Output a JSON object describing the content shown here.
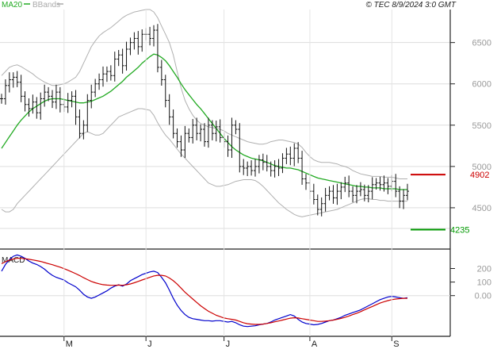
{
  "chart_data": [
    {
      "type": "ohlc",
      "header": {
        "legend": [
          {
            "label": "MA20",
            "color": "#22aa22"
          },
          {
            "label": "BBands",
            "color": "#aaaaaa"
          }
        ],
        "copyright": "© TEC 8/9/2024 3:0 GMT"
      },
      "ylim": [
        4000,
        6900
      ],
      "yticks": [
        {
          "value": 6500,
          "label": "6500"
        },
        {
          "value": 6000,
          "label": "6000"
        },
        {
          "value": 5500,
          "label": "5500"
        },
        {
          "value": 5000,
          "label": "5000"
        },
        {
          "value": 4500,
          "label": "4500"
        }
      ],
      "xticks": [
        {
          "index": 16,
          "label": "M"
        },
        {
          "index": 37,
          "label": "J"
        },
        {
          "index": 57,
          "label": "J"
        },
        {
          "index": 79,
          "label": "A"
        },
        {
          "index": 100,
          "label": "S"
        }
      ],
      "levels": [
        {
          "value": 4902,
          "label": "4902",
          "color": "#cc0000"
        },
        {
          "value": 4235,
          "label": "4235",
          "color": "#009900"
        }
      ],
      "close": [
        5820,
        5980,
        6050,
        6080,
        6020,
        5850,
        5750,
        5700,
        5780,
        5650,
        5820,
        5900,
        5850,
        5780,
        5900,
        5750,
        5720,
        5800,
        5850,
        5600,
        5400,
        5500,
        5800,
        5900,
        6000,
        6050,
        6120,
        6150,
        6100,
        6300,
        6350,
        6220,
        6420,
        6500,
        6550,
        6450,
        6600,
        6600,
        6550,
        6650,
        6200,
        6050,
        5800,
        5600,
        5400,
        5300,
        5200,
        5400,
        5350,
        5500,
        5400,
        5450,
        5300,
        5500,
        5400,
        5480,
        5350,
        5300,
        5200,
        5500,
        5450,
        5000,
        4980,
        5000,
        4950,
        5000,
        5080,
        5050,
        5000,
        4950,
        5000,
        4980,
        5100,
        5150,
        5100,
        5220,
        5100,
        4850,
        4800,
        4700,
        4600,
        4480,
        4550,
        4650,
        4700,
        4620,
        4700,
        4750,
        4800,
        4700,
        4650,
        4700,
        4720,
        4650,
        4700,
        4780,
        4800,
        4780,
        4800,
        4760,
        4820,
        4700,
        4580,
        4650,
        4700
      ],
      "ma20": [
        5220,
        5290,
        5360,
        5430,
        5500,
        5560,
        5610,
        5660,
        5700,
        5730,
        5760,
        5790,
        5810,
        5820,
        5820,
        5820,
        5810,
        5800,
        5790,
        5780,
        5770,
        5770,
        5780,
        5790,
        5810,
        5830,
        5850,
        5880,
        5910,
        5950,
        5990,
        6030,
        6080,
        6120,
        6160,
        6200,
        6250,
        6290,
        6330,
        6360,
        6350,
        6320,
        6280,
        6220,
        6150,
        6080,
        6000,
        5930,
        5870,
        5810,
        5750,
        5700,
        5640,
        5580,
        5520,
        5460,
        5400,
        5340,
        5290,
        5240,
        5200,
        5170,
        5140,
        5120,
        5100,
        5090,
        5080,
        5070,
        5050,
        5030,
        5010,
        5000,
        4990,
        4980,
        4980,
        4970,
        4960,
        4940,
        4920,
        4900,
        4880,
        4860,
        4850,
        4840,
        4830,
        4820,
        4810,
        4800,
        4790,
        4780,
        4770,
        4760,
        4760,
        4750,
        4750,
        4740,
        4740,
        4740,
        4730,
        4730,
        4730,
        4730,
        4720,
        4720,
        4720
      ],
      "bb_upper": [
        6100,
        6150,
        6200,
        6220,
        6230,
        6210,
        6180,
        6150,
        6120,
        6080,
        6050,
        6020,
        6000,
        5980,
        5980,
        5990,
        6000,
        6020,
        6050,
        6080,
        6150,
        6250,
        6350,
        6450,
        6520,
        6580,
        6620,
        6650,
        6680,
        6720,
        6760,
        6800,
        6830,
        6850,
        6870,
        6880,
        6890,
        6900,
        6900,
        6870,
        6800,
        6700,
        6600,
        6500,
        6350,
        6150,
        5950,
        5800,
        5700,
        5620,
        5560,
        5520,
        5500,
        5480,
        5470,
        5460,
        5450,
        5430,
        5400,
        5380,
        5360,
        5340,
        5320,
        5300,
        5290,
        5280,
        5270,
        5270,
        5280,
        5300,
        5310,
        5320,
        5320,
        5310,
        5300,
        5290,
        5270,
        5230,
        5170,
        5120,
        5080,
        5060,
        5050,
        5050,
        5050,
        5040,
        5030,
        5010,
        5000,
        4980,
        4950,
        4930,
        4910,
        4900,
        4890,
        4880,
        4880,
        4880,
        4870,
        4870,
        4870,
        4860,
        4850,
        4850,
        4850
      ],
      "bb_lower": [
        4480,
        4450,
        4450,
        4480,
        4550,
        4600,
        4650,
        4700,
        4750,
        4800,
        4850,
        4900,
        4950,
        5000,
        5050,
        5100,
        5150,
        5200,
        5250,
        5300,
        5350,
        5400,
        5420,
        5400,
        5380,
        5380,
        5400,
        5450,
        5500,
        5550,
        5600,
        5620,
        5640,
        5660,
        5680,
        5700,
        5700,
        5690,
        5680,
        5620,
        5530,
        5450,
        5380,
        5330,
        5270,
        5210,
        5150,
        5100,
        5050,
        5000,
        4950,
        4900,
        4850,
        4800,
        4780,
        4760,
        4760,
        4770,
        4780,
        4800,
        4820,
        4830,
        4840,
        4840,
        4840,
        4830,
        4800,
        4760,
        4710,
        4660,
        4610,
        4560,
        4520,
        4480,
        4450,
        4420,
        4400,
        4390,
        4400,
        4410,
        4420,
        4430,
        4440,
        4450,
        4460,
        4470,
        4480,
        4500,
        4520,
        4540,
        4560,
        4580,
        4600,
        4610,
        4610,
        4600,
        4600,
        4590,
        4590,
        4580,
        4580,
        4580,
        4580,
        4580,
        4580
      ]
    },
    {
      "type": "line",
      "title": "MACD",
      "ylim": [
        -300,
        320
      ],
      "yticks": [
        {
          "value": 200,
          "label": "200"
        },
        {
          "value": 100,
          "label": "100"
        },
        {
          "value": 0,
          "label": "0.00"
        }
      ],
      "series": [
        {
          "color": "#0000cc",
          "values": [
            180,
            230,
            265,
            290,
            300,
            290,
            275,
            255,
            240,
            230,
            215,
            195,
            170,
            150,
            135,
            125,
            115,
            95,
            80,
            65,
            40,
            10,
            -10,
            -20,
            -10,
            5,
            20,
            35,
            55,
            70,
            80,
            70,
            85,
            110,
            125,
            140,
            155,
            165,
            175,
            180,
            170,
            135,
            95,
            40,
            -20,
            -70,
            -110,
            -140,
            -160,
            -170,
            -175,
            -180,
            -185,
            -185,
            -188,
            -185,
            -185,
            -190,
            -195,
            -190,
            -200,
            -215,
            -225,
            -228,
            -225,
            -222,
            -215,
            -210,
            -205,
            -195,
            -180,
            -170,
            -160,
            -150,
            -140,
            -150,
            -175,
            -195,
            -205,
            -210,
            -215,
            -212,
            -205,
            -195,
            -185,
            -180,
            -170,
            -160,
            -145,
            -135,
            -125,
            -115,
            -105,
            -90,
            -75,
            -60,
            -45,
            -30,
            -20,
            -10,
            -5,
            -10,
            -15,
            -20,
            -15
          ]
        },
        {
          "color": "#cc0000",
          "values": [
            235,
            250,
            262,
            270,
            275,
            275,
            272,
            268,
            263,
            258,
            252,
            244,
            236,
            228,
            219,
            210,
            199,
            187,
            175,
            162,
            148,
            132,
            118,
            105,
            95,
            87,
            81,
            78,
            76,
            76,
            78,
            76,
            80,
            86,
            95,
            105,
            115,
            125,
            135,
            145,
            150,
            150,
            145,
            130,
            110,
            85,
            55,
            25,
            0,
            -25,
            -50,
            -75,
            -95,
            -115,
            -130,
            -145,
            -155,
            -165,
            -170,
            -175,
            -180,
            -190,
            -200,
            -207,
            -210,
            -212,
            -212,
            -210,
            -205,
            -200,
            -193,
            -187,
            -180,
            -173,
            -166,
            -163,
            -165,
            -170,
            -175,
            -180,
            -185,
            -190,
            -190,
            -188,
            -185,
            -180,
            -175,
            -168,
            -160,
            -150,
            -140,
            -130,
            -118,
            -105,
            -92,
            -80,
            -67,
            -55,
            -45,
            -37,
            -30,
            -25,
            -22,
            -20,
            -20
          ]
        }
      ]
    }
  ]
}
